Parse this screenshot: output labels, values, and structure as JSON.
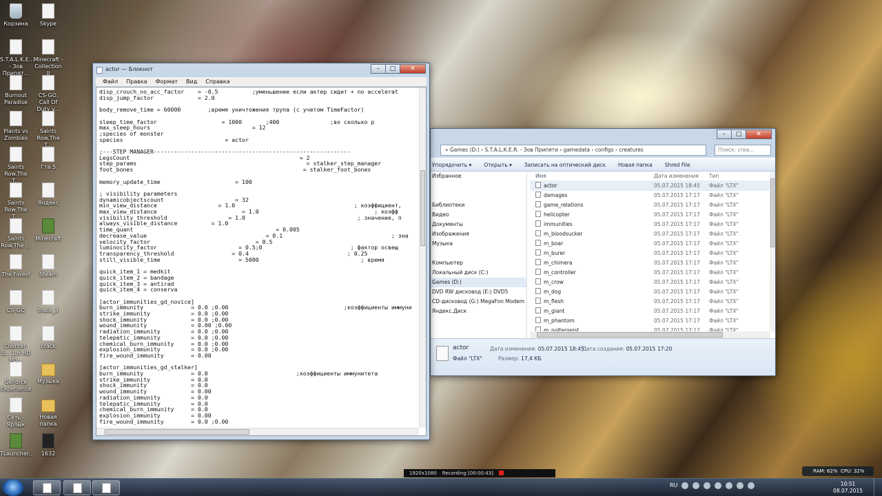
{
  "desktop_icons": [
    {
      "label": "Корзина",
      "kind": "bin"
    },
    {
      "label": "Skype",
      "kind": "file"
    },
    {
      "label": "S.T.A.L.K.E... - Зов Припят...",
      "kind": "file"
    },
    {
      "label": "Minecraft - Collection II",
      "kind": "file"
    },
    {
      "label": "Burnout Paradise",
      "kind": "file"
    },
    {
      "label": "CS-GO. Call Of Duty v...",
      "kind": "file"
    },
    {
      "label": "Plants vs Zombies",
      "kind": "file"
    },
    {
      "label": "Saints Row.The T...",
      "kind": "file"
    },
    {
      "label": "Saints Row.The T...",
      "kind": "file"
    },
    {
      "label": "Гта 5",
      "kind": "file"
    },
    {
      "label": "Saints Row.The T...",
      "kind": "file"
    },
    {
      "label": "Яндекс",
      "kind": "file"
    },
    {
      "label": "Saints Row.The ...",
      "kind": "file"
    },
    {
      "label": "Minecraft",
      "kind": "green"
    },
    {
      "label": "The Forest",
      "kind": "file"
    },
    {
      "label": "Steam",
      "kind": "file"
    },
    {
      "label": "CS-GO",
      "kind": "file"
    },
    {
      "label": "track_3",
      "kind": "file"
    },
    {
      "label": "Counter-S... 1.6 HD Mo...",
      "kind": "file"
    },
    {
      "label": "crack",
      "kind": "file"
    },
    {
      "label": "GeForce Experience",
      "kind": "file"
    },
    {
      "label": "Музыка",
      "kind": "folder"
    },
    {
      "label": "Сеть - Ярлык",
      "kind": "file"
    },
    {
      "label": "Новая папка",
      "kind": "folder"
    },
    {
      "label": "TLauncher...",
      "kind": "green"
    },
    {
      "label": "1632",
      "kind": "dark"
    }
  ],
  "notepad": {
    "title": "actor — Блокнот",
    "menu": [
      "Файл",
      "Правка",
      "Формат",
      "Вид",
      "Справка"
    ],
    "lines": [
      "disp_crouch_no_acc_factor    = -0.5          ;уменьшение если актер сидит + no accelerat",
      "disp_jump_factor             = 2.0",
      "",
      "body_remove_time = 60000        ;время уничтожения трупа (с учетом TimeFactor)",
      "",
      "sleep_time_factor                   = 1000       ;400               ;во сколько р",
      "max_sleep_hours                              = 12",
      ";species of monster",
      "species                              = actor",
      "",
      ";---STEP MANAGER----------------------------------------------------------",
      "LegsCount                                                  = 2",
      "step_params                                                  = stalker_step_manager",
      "foot_bones                                                  = stalker_foot_bones",
      "",
      "memory_update_time                      = 100",
      "",
      "; visibility parameters",
      "dynamicobjectscount                     = 32",
      "min_view_distance                  = 1.0                                   ; коэффициент,",
      "max_view_distance                         = 1.0                                  ; коэфф",
      "visibility_threshold                  = 1.0                                 ; значение, п",
      "always_visible_distance          = 1.0",
      "time_quant                                          = 0.005",
      "decrease_value                                   = 0.1                                ; зна",
      "velocity_factor                               = 0.5",
      "luminocity_factor                        = 0.5;0                          ; фактор освещ",
      "transparency_threshold                 = 0.4                             ; 0.25",
      "still_visible_time                       = 5000                              ; время",
      "",
      "quick_item_1 = medkit",
      "quick_item_2 = bandage",
      "quick_item_3 = antirad",
      "quick_item_4 = conserva",
      "",
      "[actor_immunities_gd_novice]",
      "burn_immunity              = 0.0 ;0.00                                  ;коэффициенты иммуни",
      "strike_immunity            = 0.0 ;0.00",
      "shock_immunity             = 0.0 ;0.00",
      "wound_immunity             = 0.00 ;0.00",
      "radiation_immunity         = 0.0 ;0.00",
      "telepatic_immunity         = 0.0 ;0.00",
      "chemical_burn_immunity     = 0.0 ;0.00",
      "explosion_immunity         = 0.0 ;0.00",
      "fire_wound_immunity        = 0.00",
      "",
      "[actor_immunities_gd_stalker]",
      "burn_immunity              = 0.0                          ;коэффициенты иммунитета",
      "strike_immunity            = 0.0",
      "shock_immunity             = 0.0",
      "wound_immunity             = 0.00",
      "radiation_immunity         = 0.0",
      "telepatic_immunity         = 0.0",
      "chemical_burn_immunity     = 0.0",
      "explosion_immunity         = 0.00",
      "fire_wound_immunity        = 0.0 ;0.00"
    ]
  },
  "explorer": {
    "breadcrumb": "« Games (D:) › S.T.A.L.K.E.R. - Зов Припяти › gamedata › configs › creatures",
    "search_placeholder": "Поиск: crea...",
    "toolbar": [
      "Упорядочить ▾",
      "Открыть ▾",
      "Записать на оптический диск",
      "Новая папка",
      "Shred File"
    ],
    "nav": [
      "Избранное",
      "",
      "",
      "Библиотеки",
      "Видео",
      "Документы",
      "Изображения",
      "Музыка",
      "",
      "Компьютер",
      "Локальный диск (C:)",
      "Games (D:)",
      "DVD RW дисковод (E:) DVD5",
      "CD-дисковод (G:) MegaFon Modem",
      "Яндекс.Диск"
    ],
    "nav_selected": 11,
    "columns": {
      "name": "Имя",
      "date": "Дата изменения",
      "type": "Тип"
    },
    "files": [
      {
        "name": "actor",
        "date": "05.07.2015 18:45",
        "type": "Файл \"LTX\""
      },
      {
        "name": "damages",
        "date": "05.07.2015 17:17",
        "type": "Файл \"LTX\""
      },
      {
        "name": "game_relations",
        "date": "05.07.2015 17:17",
        "type": "Файл \"LTX\""
      },
      {
        "name": "helicopter",
        "date": "05.07.2015 17:17",
        "type": "Файл \"LTX\""
      },
      {
        "name": "immunities",
        "date": "05.07.2015 17:17",
        "type": "Файл \"LTX\""
      },
      {
        "name": "m_bloodsucker",
        "date": "05.07.2015 17:17",
        "type": "Файл \"LTX\""
      },
      {
        "name": "m_boar",
        "date": "05.07.2015 17:17",
        "type": "Файл \"LTX\""
      },
      {
        "name": "m_burer",
        "date": "05.07.2015 17:17",
        "type": "Файл \"LTX\""
      },
      {
        "name": "m_chimera",
        "date": "05.07.2015 17:17",
        "type": "Файл \"LTX\""
      },
      {
        "name": "m_controller",
        "date": "05.07.2015 17:17",
        "type": "Файл \"LTX\""
      },
      {
        "name": "m_crow",
        "date": "05.07.2015 17:17",
        "type": "Файл \"LTX\""
      },
      {
        "name": "m_dog",
        "date": "05.07.2015 17:17",
        "type": "Файл \"LTX\""
      },
      {
        "name": "m_flesh",
        "date": "05.07.2015 17:17",
        "type": "Файл \"LTX\""
      },
      {
        "name": "m_giant",
        "date": "05.07.2015 17:17",
        "type": "Файл \"LTX\""
      },
      {
        "name": "m_phantom",
        "date": "05.07.2015 17:17",
        "type": "Файл \"LTX\""
      },
      {
        "name": "m_poltergeist",
        "date": "05.07.2015 17:17",
        "type": "Файл \"LTX\""
      }
    ],
    "selected_file": 0,
    "details": {
      "name": "actor",
      "type": "Файл \"LTX\"",
      "modified_label": "Дата изменения:",
      "modified": "05.07.2015 18:45",
      "created_label": "Дата создания:",
      "created": "05.07.2015 17:20",
      "size_label": "Размер:",
      "size": "17,4 КБ"
    }
  },
  "recorder": {
    "resolution": "1920x1080",
    "status": "Recording [00:00:43]"
  },
  "tray": {
    "ram": "RAM: 62%",
    "cpu": "CPU: 32%",
    "lang": "RU",
    "time": "10:51",
    "date": "08.07.2015"
  }
}
